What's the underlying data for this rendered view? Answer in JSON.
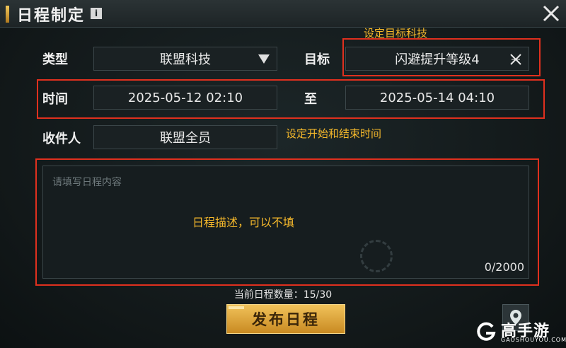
{
  "header": {
    "title": "日程制定",
    "info_icon": "i"
  },
  "form": {
    "type": {
      "label": "类型",
      "value": "联盟科技"
    },
    "target": {
      "label": "目标",
      "value": "闪避提升等级4"
    },
    "time": {
      "label": "时间",
      "start": "2025-05-12 02:10",
      "to_label": "至",
      "end": "2025-05-14 04:10"
    },
    "recipient": {
      "label": "收件人",
      "value": "联盟全员"
    },
    "content": {
      "placeholder": "请填写日程内容",
      "counter": "0/2000"
    }
  },
  "annotations": {
    "target_note": "设定目标科技",
    "time_note": "设定开始和结束时间",
    "content_note": "日程描述，可以不填"
  },
  "footer": {
    "schedule_count": "当前日程数量：15/30",
    "publish_label": "发布日程"
  },
  "watermark": {
    "name": "高手游",
    "domain": "GAOSHOUYOU.COM"
  },
  "colors": {
    "accent": "#f0c25a",
    "annotation_box": "#e0301e",
    "annotation_text": "#f6b92b"
  },
  "icons": [
    "info-icon",
    "close-icon",
    "chevron-down-icon",
    "clear-icon",
    "location-pin-icon"
  ]
}
